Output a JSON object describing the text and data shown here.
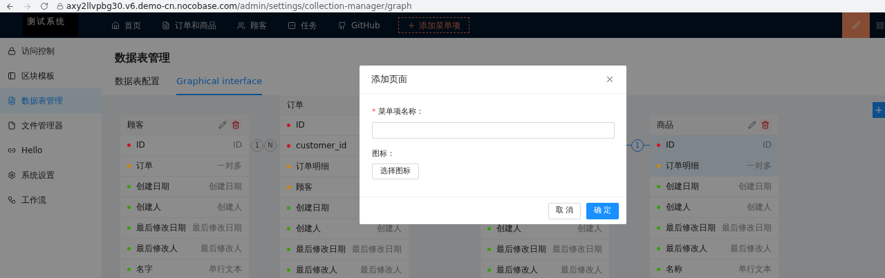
{
  "browser": {
    "url_host": "axy2llvpbg30.v6.demo-cn.nocobase.com",
    "url_path": "/admin/settings/collection-manager/graph"
  },
  "topbar": {
    "logo": "测试系统",
    "items": [
      {
        "label": "首页"
      },
      {
        "label": "订单和商品"
      },
      {
        "label": "顾客"
      },
      {
        "label": "任务"
      },
      {
        "label": "GitHub"
      }
    ],
    "add_button": "添加菜单项"
  },
  "sidebar": {
    "items": [
      {
        "label": "访问控制",
        "selected": false
      },
      {
        "label": "区块模板",
        "selected": false
      },
      {
        "label": "数据表管理",
        "selected": true
      },
      {
        "label": "文件管理器",
        "selected": false
      },
      {
        "label": "Hello",
        "selected": false
      },
      {
        "label": "系统设置",
        "selected": false
      },
      {
        "label": "工作流",
        "selected": false
      }
    ]
  },
  "page": {
    "title": "数据表管理",
    "tabs": [
      {
        "label": "数据表配置",
        "selected": false
      },
      {
        "label": "Graphical interface",
        "selected": true
      }
    ]
  },
  "cards": [
    {
      "title": "顾客",
      "actions": true,
      "fields": [
        {
          "name": "ID",
          "type": "ID",
          "color": "#cf1322",
          "highlighted": false
        },
        {
          "name": "订单",
          "type": "一对多",
          "color": "#d48806",
          "highlighted": false
        },
        {
          "name": "创建日期",
          "type": "创建日期",
          "color": "#389e0d",
          "highlighted": false
        },
        {
          "name": "创建人",
          "type": "创建人",
          "color": "#389e0d",
          "highlighted": false
        },
        {
          "name": "最后修改日期",
          "type": "最后修改日期",
          "color": "#389e0d",
          "highlighted": false
        },
        {
          "name": "最后修改人",
          "type": "最后修改人",
          "color": "#389e0d",
          "highlighted": false
        },
        {
          "name": "名字",
          "type": "单行文本",
          "color": "#389e0d",
          "highlighted": false
        }
      ]
    },
    {
      "title": "订单",
      "fields": [
        {
          "name": "ID",
          "color": "#cf1322",
          "highlighted": false
        },
        {
          "name": "customer_id",
          "color": "#cf1322",
          "highlighted": false
        },
        {
          "name": "订单明细",
          "color": "#d48806",
          "highlighted": false
        },
        {
          "name": "顾客",
          "color": "#d48806",
          "highlighted": false
        },
        {
          "name": "创建日期",
          "color": "#389e0d",
          "highlighted": false
        },
        {
          "name": "创建人",
          "type": "创建人",
          "color": "#389e0d",
          "highlighted": false
        },
        {
          "name": "最后修改日期",
          "type": "最后修改日期",
          "color": "#389e0d",
          "highlighted": false
        },
        {
          "name": "最后修改人",
          "type": "最后修改人",
          "color": "#389e0d",
          "highlighted": false
        }
      ]
    },
    {
      "fields": [
        {
          "name": "创建人",
          "type": "创建人",
          "color": "#389e0d",
          "highlighted": false
        },
        {
          "name": "最后修改日期",
          "type": "最后修改日期",
          "color": "#389e0d",
          "highlighted": false
        },
        {
          "name": "最后修改人",
          "type": "最后修改人",
          "color": "#389e0d",
          "highlighted": false
        }
      ]
    },
    {
      "title": "商品",
      "actions": true,
      "fields": [
        {
          "name": "ID",
          "type": "ID",
          "color": "#cf1322",
          "highlighted": true
        },
        {
          "name": "订单明细",
          "type": "一对多",
          "color": "#d48806",
          "highlighted": true
        },
        {
          "name": "创建日期",
          "type": "创建日期",
          "color": "#389e0d",
          "highlighted": false
        },
        {
          "name": "创建人",
          "type": "创建人",
          "color": "#389e0d",
          "highlighted": false
        },
        {
          "name": "最后修改日期",
          "type": "最后修改日期",
          "color": "#389e0d",
          "highlighted": false
        },
        {
          "name": "最后修改人",
          "type": "最后修改人",
          "color": "#389e0d",
          "highlighted": false
        },
        {
          "name": "名称",
          "type": "单行文本",
          "color": "#389e0d",
          "highlighted": false
        }
      ]
    }
  ],
  "relations": [
    {
      "labels": [
        "1",
        "N"
      ],
      "highlighted": false
    },
    {
      "labels": [
        "1"
      ],
      "highlighted": true
    }
  ],
  "add_collection_button": "+",
  "dialog": {
    "title": "添加页面",
    "fields": [
      {
        "kind": "input",
        "label": "菜单项名称：",
        "required_mark": "*"
      },
      {
        "kind": "icon_picker",
        "label": "图标：",
        "button": "选择图标"
      }
    ],
    "cancel": "取 消",
    "ok": "确 定"
  }
}
